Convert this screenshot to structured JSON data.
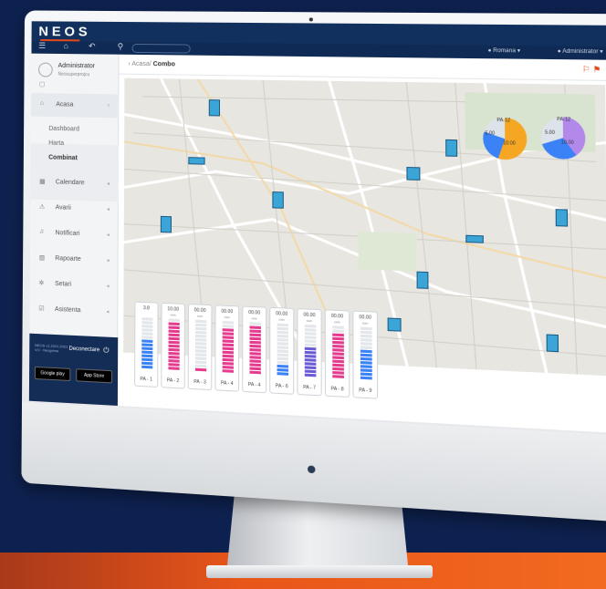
{
  "app": {
    "logo": "NEOS",
    "search_placeholder": "",
    "language": "Romana",
    "admin_top": "Administrator"
  },
  "sidebar": {
    "user_name": "Administrator",
    "user_sub": "Neosuperprojcu",
    "items": [
      {
        "label": "Acasa"
      },
      {
        "label": "Calendare"
      },
      {
        "label": "Avarii"
      },
      {
        "label": "Notificari"
      },
      {
        "label": "Rapoarte"
      },
      {
        "label": "Setari"
      },
      {
        "label": "Asistenta"
      }
    ],
    "sub_items": [
      {
        "label": "Dashboard"
      },
      {
        "label": "Harta"
      },
      {
        "label": "Combinat"
      }
    ],
    "logout": "Deconectare",
    "version": "NEOS v1.2021.2021 V.0 · Neogrima",
    "google_play": "Google play",
    "app_store": "App Store"
  },
  "main": {
    "breadcrumb_root": "Acasa/",
    "breadcrumb_current": "Combo"
  },
  "gauges": [
    {
      "value": "3.8",
      "unit": "",
      "name": "PA - 1",
      "fill": 0.55,
      "color": "#3b82f6"
    },
    {
      "value": "10.00",
      "unit": "kWh",
      "name": "PA - 2",
      "fill": 0.95,
      "color": "#e43b8f"
    },
    {
      "value": "00.00",
      "unit": "kWh",
      "name": "PA - 3",
      "fill": 0.1,
      "color": "#e43b8f"
    },
    {
      "value": "00.00",
      "unit": "kWh",
      "name": "PA - 4",
      "fill": 0.85,
      "color": "#e43b8f"
    },
    {
      "value": "00.00",
      "unit": "kWh",
      "name": "PA - 4",
      "fill": 0.9,
      "color": "#e43b8f"
    },
    {
      "value": "00.00",
      "unit": "kWh",
      "name": "PA - 6",
      "fill": 0.2,
      "color": "#3b82f6"
    },
    {
      "value": "00.00",
      "unit": "kWh",
      "name": "PA - 7",
      "fill": 0.55,
      "color": "#6b5bd6"
    },
    {
      "value": "00.00",
      "unit": "kWh",
      "name": "PA - 8",
      "fill": 0.85,
      "color": "#e43b8f"
    },
    {
      "value": "00.00",
      "unit": "kWh",
      "name": "PA - 9",
      "fill": 0.6,
      "color": "#3b82f6"
    }
  ],
  "pies": [
    {
      "title": "PA-12",
      "value1": "5.00",
      "value2": "10.00"
    },
    {
      "title": "PA-12",
      "value1": "5.00",
      "value2": "10.00"
    }
  ],
  "colors": {
    "brand_dark": "#12305e",
    "accent": "#e64a19",
    "bg": "#0d2150"
  }
}
